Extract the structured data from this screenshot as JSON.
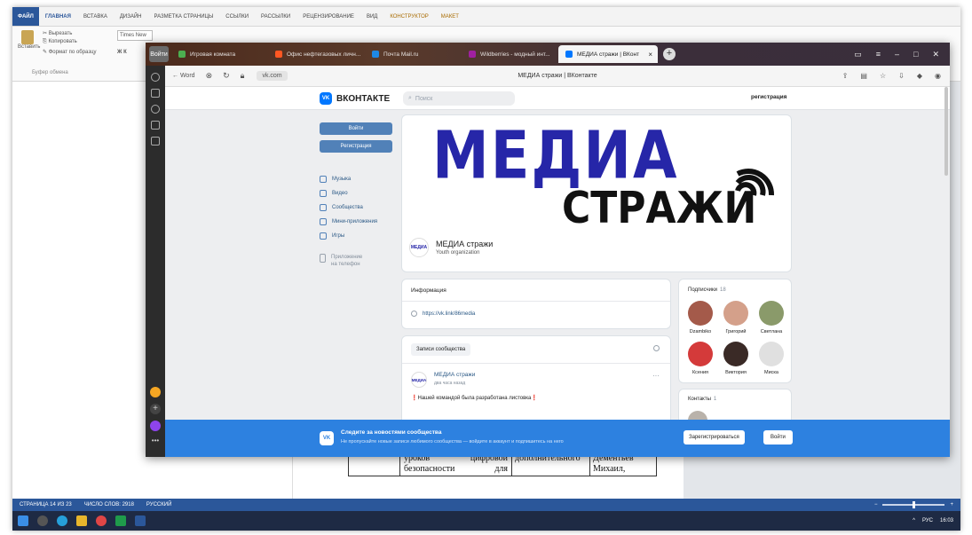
{
  "word": {
    "ribbon_tabs": [
      "ФАЙЛ",
      "ГЛАВНАЯ",
      "ВСТАВКА",
      "ДИЗАЙН",
      "РАЗМЕТКА СТРАНИЦЫ",
      "ССЫЛКИ",
      "РАССЫЛКИ",
      "РЕЦЕНЗИРОВАНИЕ",
      "ВИД",
      "КОНСТРУКТОР",
      "МАКЕТ"
    ],
    "paste_label": "Вставить",
    "cut_label": "Вырезать",
    "copy_label": "Копировать",
    "format_label": "Формат по образцу",
    "clipboard_group": "Буфер обмена",
    "font_name": "Times New",
    "bold_italic": "Ж К",
    "table_cells": {
      "c1_line1_a": "уроков",
      "c1_line1_b": "цифровой",
      "c1_line2_a": "безопасности",
      "c1_line2_b": "для",
      "c2_line1": "дополнительного",
      "c3_line1": "Дементьев",
      "c3_line2": "Михаил,"
    },
    "status": {
      "page": "СТРАНИЦА 14 ИЗ 23",
      "words": "ЧИСЛО СЛОВ: 2918",
      "language": "РУССКИЙ"
    },
    "taskbar_tray": "РУС",
    "time": "16:03"
  },
  "browser": {
    "yandex_label": "Войти",
    "tabs": [
      {
        "label": "Игровая комната",
        "color": "#4caf50"
      },
      {
        "label": "Офис нефтегазовых личн...",
        "color": "#ff5722"
      },
      {
        "label": "Почта Mail.ru",
        "color": "#1e88e5"
      },
      {
        "label": "Wildberries - модный инт...",
        "color": "#a020a0"
      }
    ],
    "active_tab": {
      "label": "МЕДИА стражи | ВКонт",
      "color": "#0077ff"
    },
    "back_label": "Word",
    "url": "vk.com",
    "page_title": "МЕДИА стражи | ВКонтакте"
  },
  "vk": {
    "logo_text": "ВКОНТАКТЕ",
    "logo_mark": "VK",
    "search_placeholder": "Поиск",
    "register_link": "регистрация",
    "login_button": "Войти",
    "register_button": "Регистрация",
    "nav": [
      "Музыка",
      "Видео",
      "Сообщества",
      "Мини-приложения",
      "Игры"
    ],
    "apps_line1": "Приложение",
    "apps_line2": "на телефон",
    "cover_big": "МЕДИА",
    "cover_small": "СТРАЖИ",
    "group_avatar": "МЕДИА",
    "group_name": "МЕДИА стражи",
    "group_type": "Youth organization",
    "info_title": "Информация",
    "info_link": "https://vk.link/86media",
    "posts_tab": "Записи сообщества",
    "post_author": "МЕДИА стражи",
    "post_time": "два часа назад",
    "post_text": "Нашей командой была разработана листовка",
    "subs_title": "Подписчики",
    "subs_count": "18",
    "subscribers": [
      {
        "name": "Dzambiko",
        "color": "#a45a4a"
      },
      {
        "name": "Григорий",
        "color": "#d4a08a"
      },
      {
        "name": "Светлана",
        "color": "#8a9a6a"
      },
      {
        "name": "Ксения",
        "color": "#d43a3a"
      },
      {
        "name": "Виктория",
        "color": "#3a2a26"
      },
      {
        "name": "Миска",
        "color": "#e0e0e0"
      }
    ],
    "contacts_title": "Контакты",
    "contacts_count": "1",
    "banner_mark": "VK",
    "banner_title": "Следите за новостями сообщества",
    "banner_sub": "Не пропускайте новые записи любимого сообщества — войдите в аккаунт и подпишитесь на него",
    "banner_register": "Зарегистрироваться",
    "banner_login": "Войти"
  }
}
